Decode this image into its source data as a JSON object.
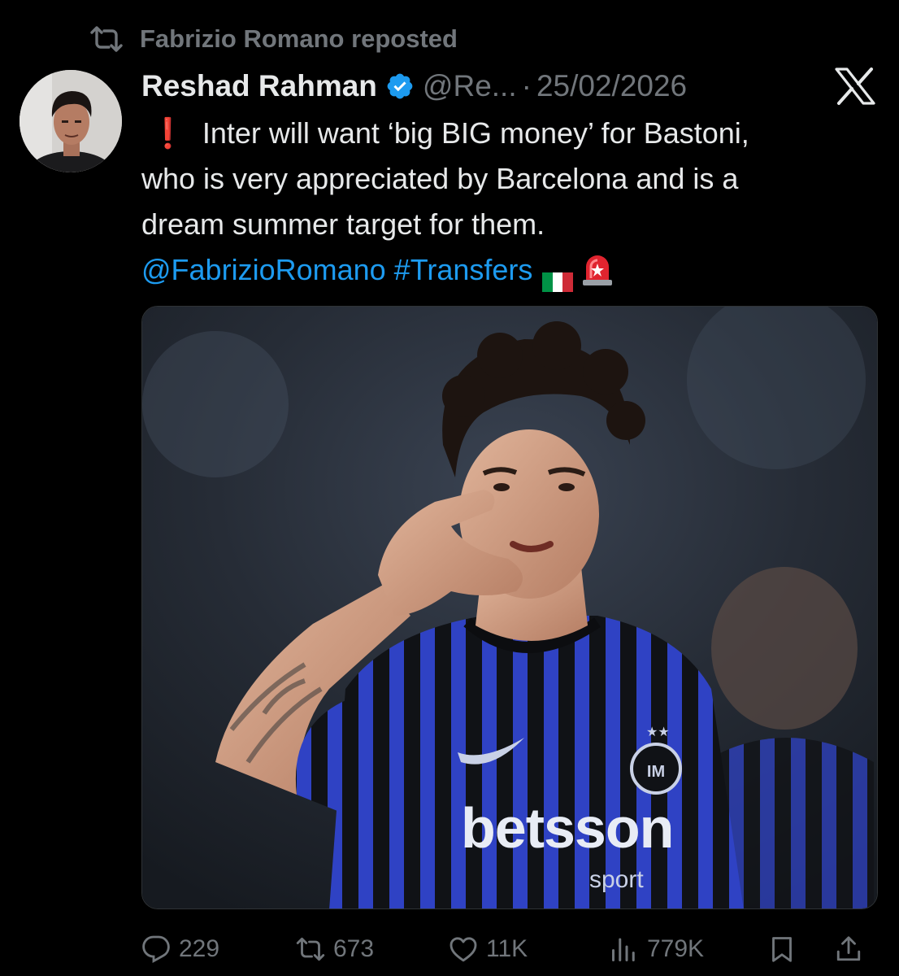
{
  "repost_header": {
    "text": "Fabrizio Romano reposted",
    "icon": "repost-icon"
  },
  "tweet": {
    "author": {
      "display_name": "Reshad Rahman",
      "handle": "@Re...",
      "verified": true,
      "verified_icon": "verified-badge-icon"
    },
    "separator": "·",
    "date": "25/02/2026",
    "platform_icon": "x-logo-icon",
    "text": {
      "alert_glyph": "❗",
      "line1": "Inter will want ‘big BIG money’ for Bastoni,",
      "line2": "who is very appreciated by Barcelona and is a",
      "line3": "dream summer target for them.",
      "mention": "@FabrizioRomano",
      "hashtag": "#Transfers",
      "emoji_flag": "italy-flag-icon",
      "emoji_siren": "siren-icon"
    },
    "media": {
      "kind": "photo",
      "shirt_sponsor": "betsson",
      "shirt_sponsor_sub": "sport"
    },
    "actions": {
      "replies": "229",
      "reposts": "673",
      "likes": "11K",
      "views": "779K"
    }
  },
  "colors": {
    "background": "#000000",
    "primary_text": "#e7e9ea",
    "secondary_text": "#71767b",
    "link": "#1d9bf0",
    "verified": "#1d9bf0",
    "alert": "#f4212e"
  }
}
